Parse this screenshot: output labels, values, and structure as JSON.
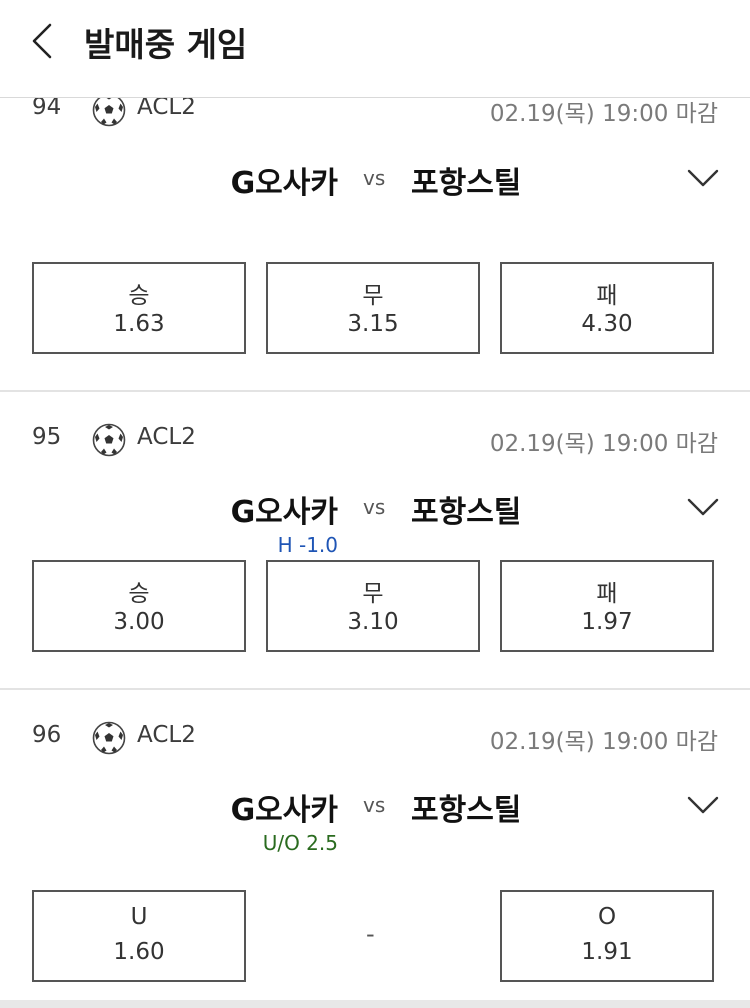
{
  "header": {
    "title": "발매중 게임"
  },
  "games": [
    {
      "number": "94",
      "league": "ACL2",
      "deadline": "02.19(목) 19:00 마감",
      "home": "G오사카",
      "vs": "vs",
      "away": "포항스틸",
      "odds": [
        {
          "label": "승",
          "value": "1.63"
        },
        {
          "label": "무",
          "value": "3.15"
        },
        {
          "label": "패",
          "value": "4.30"
        }
      ]
    },
    {
      "number": "95",
      "league": "ACL2",
      "deadline": "02.19(목) 19:00 마감",
      "home": "G오사카",
      "vs": "vs",
      "away": "포항스틸",
      "handicap": "H -1.0",
      "handicap_color": "#1f55b5",
      "odds": [
        {
          "label": "승",
          "value": "3.00"
        },
        {
          "label": "무",
          "value": "3.10"
        },
        {
          "label": "패",
          "value": "1.97"
        }
      ]
    },
    {
      "number": "96",
      "league": "ACL2",
      "deadline": "02.19(목) 19:00 마감",
      "home": "G오사카",
      "vs": "vs",
      "away": "포항스틸",
      "handicap": "U/O 2.5",
      "handicap_color": "#2a6b1f",
      "middle": "-",
      "odds": [
        {
          "label": "U",
          "value": "1.60"
        },
        {
          "label": "O",
          "value": "1.91"
        }
      ]
    }
  ],
  "icons": {
    "back": "chevron-left-icon",
    "league": "soccer-ball-icon",
    "expand": "chevron-down-icon"
  }
}
